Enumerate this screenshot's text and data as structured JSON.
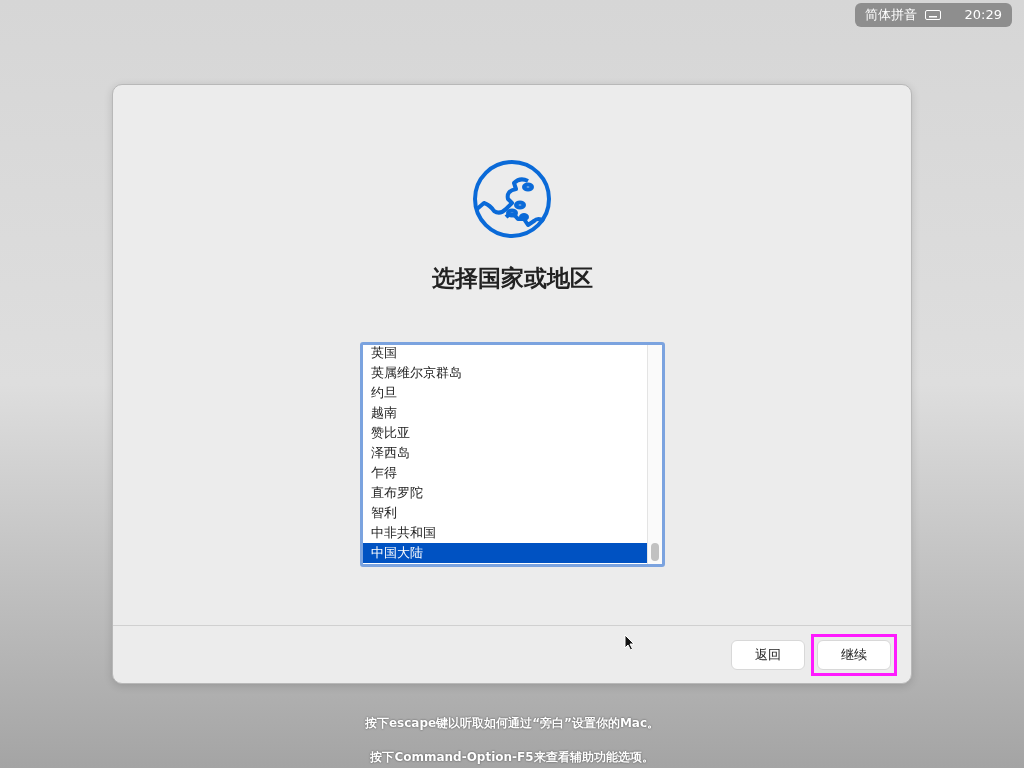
{
  "menu_bar": {
    "input_method": "简体拼音",
    "clock": "20:29"
  },
  "dialog": {
    "title": "选择国家或地区",
    "countries": [
      {
        "label": "英国",
        "selected": false
      },
      {
        "label": "英属维尔京群岛",
        "selected": false
      },
      {
        "label": "约旦",
        "selected": false
      },
      {
        "label": "越南",
        "selected": false
      },
      {
        "label": "赞比亚",
        "selected": false
      },
      {
        "label": "泽西岛",
        "selected": false
      },
      {
        "label": "乍得",
        "selected": false
      },
      {
        "label": "直布罗陀",
        "selected": false
      },
      {
        "label": "智利",
        "selected": false
      },
      {
        "label": "中非共和国",
        "selected": false
      },
      {
        "label": "中国大陆",
        "selected": true
      }
    ],
    "buttons": [
      {
        "label": "返回",
        "highlighted": false
      },
      {
        "label": "继续",
        "highlighted": true
      }
    ]
  },
  "hints": [
    "按下escape键以听取如何通过“旁白”设置你的Mac。",
    "按下Command-Option-F5来查看辅助功能选项。"
  ]
}
